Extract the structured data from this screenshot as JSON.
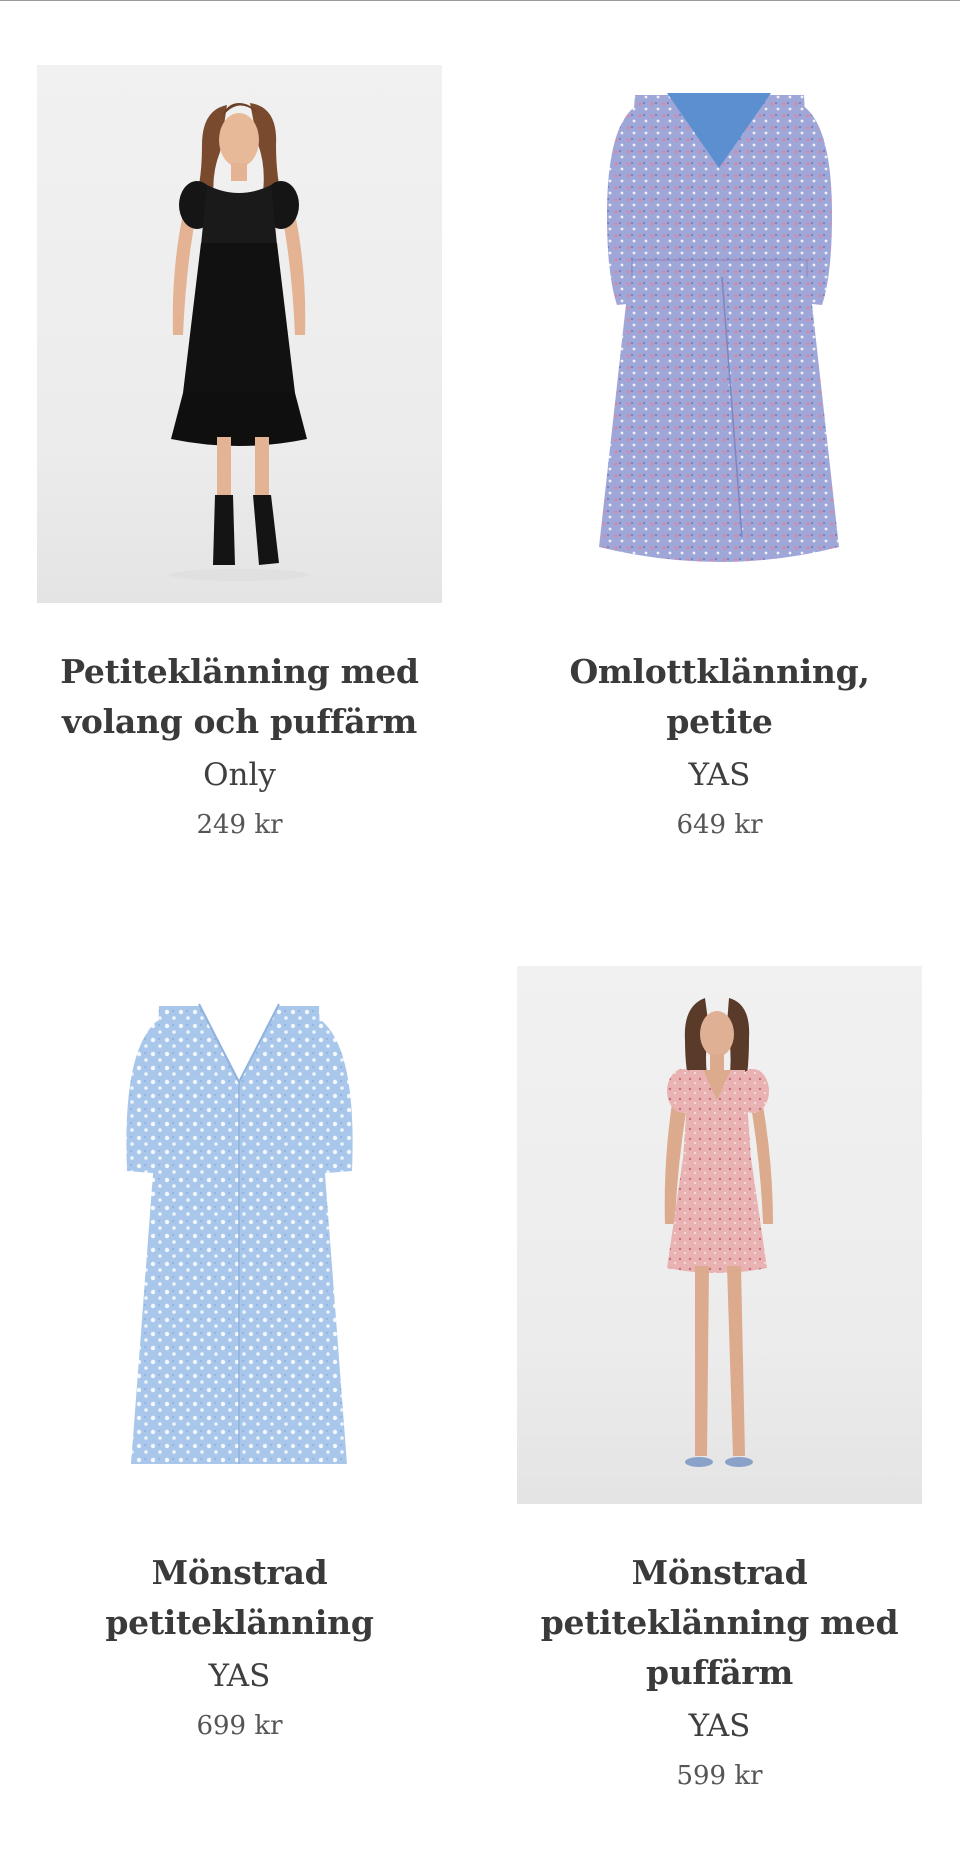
{
  "products": [
    {
      "title": "Petiteklänning med volang och puffärm",
      "brand": "Only",
      "price": "249 kr",
      "image_icon": "black-dress-model-photo"
    },
    {
      "title": "Omlottklänning, petite",
      "brand": "YAS",
      "price": "649 kr",
      "image_icon": "floral-wrap-dress-photo"
    },
    {
      "title": "Mönstrad petiteklänning",
      "brand": "YAS",
      "price": "699 kr",
      "image_icon": "light-blue-floral-dress-photo"
    },
    {
      "title": "Mönstrad petiteklänning med puffärm",
      "brand": "YAS",
      "price": "599 kr",
      "image_icon": "pink-floral-dress-model-photo"
    }
  ],
  "colors": {
    "text": "#3a3a3a",
    "price": "#555555",
    "background": "#ffffff"
  }
}
